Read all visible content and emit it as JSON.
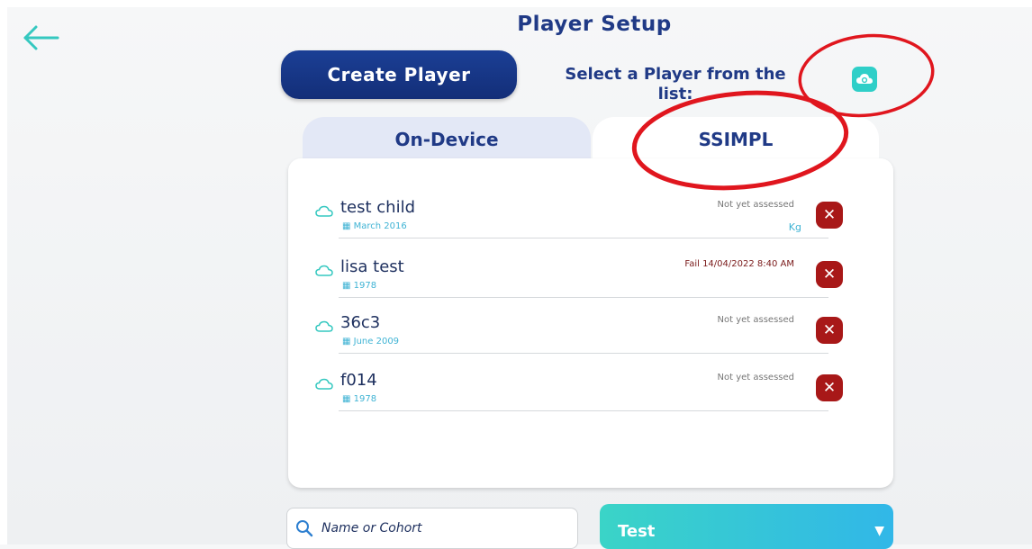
{
  "header": {
    "title": "Player Setup",
    "create_button": "Create Player",
    "select_prompt_line1": "Select a Player from the",
    "select_prompt_line2": "list:"
  },
  "tabs": [
    {
      "label": "On-Device",
      "active": false
    },
    {
      "label": "SSIMPL",
      "active": true
    }
  ],
  "players": [
    {
      "name": "test child",
      "dob": "March 2016",
      "status": "Not yet assessed",
      "extra": "Kg"
    },
    {
      "name": "lisa test",
      "dob": "1978",
      "status": "Fail 14/04/2022 8:40 AM",
      "extra": ""
    },
    {
      "name": "36c3",
      "dob": "June 2009",
      "status": "Not yet assessed",
      "extra": ""
    },
    {
      "name": "f014",
      "dob": "1978",
      "status": "Not yet assessed",
      "extra": ""
    }
  ],
  "search": {
    "placeholder": "Name or Cohort"
  },
  "dropdown": {
    "selected": "Test"
  },
  "icons": {
    "back": "arrow-left-icon",
    "cloud_sync": "cloud-sync-icon",
    "row_cloud": "cloud-icon",
    "delete": "close-icon",
    "search": "search-icon",
    "dropdown": "caret-down-icon"
  },
  "colors": {
    "accent": "#2fcfc8",
    "primary": "#1b3f95",
    "delete": "#a81818",
    "annotation": "#e0161e"
  }
}
